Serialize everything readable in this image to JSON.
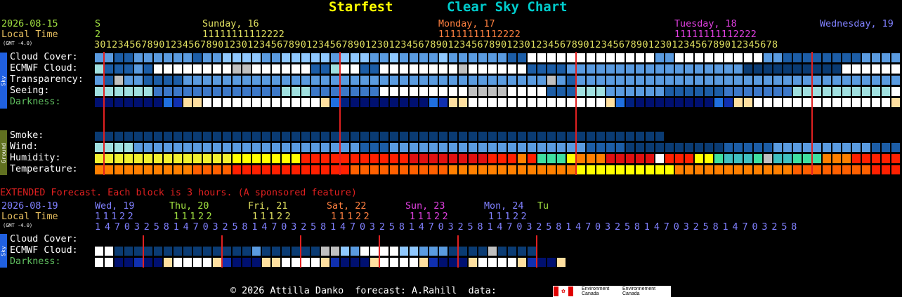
{
  "header": {
    "site_title": "Starfest",
    "chart_title": "Clear Sky Chart",
    "date": "2026-08-15",
    "local_time_label": "Local Time",
    "gmt_note": "(GMT -4.0)",
    "day_marker": "S",
    "day_marker_tens": "2",
    "days": [
      "Sunday, 16",
      "Monday, 17",
      "Tuesday, 18",
      "Wednesday, 19"
    ],
    "hour_tens_row": "11111111112222",
    "hour_digits": "30123456789012345678901230123456789012345678901230123456789012345678901230123456789012345678901230123456789012345678"
  },
  "sky_section": {
    "side_label": "Sky",
    "rows": [
      "Cloud Cover:",
      "ECMWF Cloud:",
      "Transparency:",
      "Seeing:",
      "Darkness:"
    ]
  },
  "ground_section": {
    "side_label": "Ground",
    "rows": [
      "Smoke:",
      "Wind:",
      "Humidity:",
      "Temperature:"
    ]
  },
  "extended": {
    "notice": "EXTENDED Forecast. Each block is 3 hours. (A sponsored feature)",
    "date": "2026-08-19",
    "local_time_label": "Local Time",
    "gmt_note": "(GMT -4.0)",
    "days": [
      "Wed, 19",
      "Thu, 20",
      "Fri, 21",
      "Sat, 22",
      "Sun, 23",
      "Mon, 24",
      "Tu"
    ],
    "tens_row": "11122",
    "hour_digits": "147032581470325814703258147032581470325814703258147032581470325814703258",
    "side_label": "Sky",
    "rows": [
      "Cloud Cover:",
      "ECMWF Cloud:",
      "Darkness:"
    ]
  },
  "footer": {
    "copyright": "© 2026 Attilla Danko  forecast: A.Rahill  data:",
    "logo_text_en": "Environment Canada",
    "logo_text_fr": "Environnement Canada"
  },
  "colors": {
    "site_title": "#ffff00",
    "chart_title": "#00cccc",
    "date": "#a0e040",
    "local_time": "#e8c060",
    "sunday": "#e0e060",
    "monday": "#ff8040",
    "tuesday": "#e040e0",
    "wednesday": "#8080ff",
    "midnight_line": "#e02020",
    "notice": "#e02020",
    "darkness_label": "#60c060"
  }
}
